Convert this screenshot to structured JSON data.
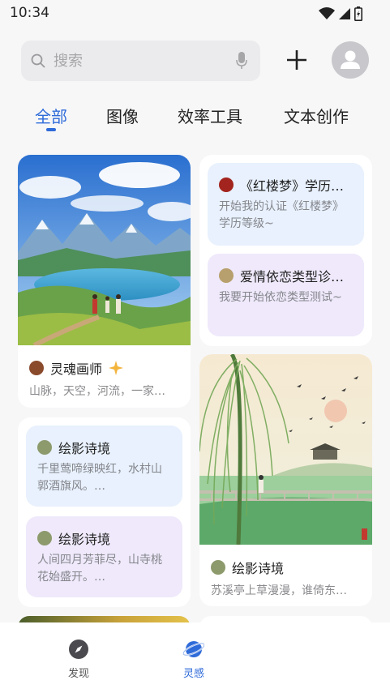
{
  "status": {
    "time": "10:34"
  },
  "search": {
    "placeholder": "搜索"
  },
  "tabs": [
    {
      "label": "全部",
      "active": true
    },
    {
      "label": "图像",
      "active": false
    },
    {
      "label": "效率工具",
      "active": false
    },
    {
      "label": "文本创作",
      "active": false
    }
  ],
  "feed": {
    "card1": {
      "author": "灵魂画师",
      "desc": "山脉，天空，河流，一家…"
    },
    "card2": {
      "items": [
        {
          "title": "《红楼梦》学历…",
          "body": "开始我的认证《红楼梦》学历等级~"
        },
        {
          "title": "爱情依恋类型诊…",
          "body": "我要开始依恋类型测试~"
        }
      ]
    },
    "card3": {
      "items": [
        {
          "title": "绘影诗境",
          "body": "千里莺啼绿映红，水村山郭酒旗风。…"
        },
        {
          "title": "绘影诗境",
          "body": "人间四月芳菲尽，山寺桃花始盛开。…"
        }
      ]
    },
    "card4": {
      "author": "绘影诗境",
      "desc": "苏溪亭上草漫漫，谁倚东…"
    }
  },
  "nav": [
    {
      "label": "发现",
      "icon": "compass-icon",
      "active": false
    },
    {
      "label": "灵感",
      "icon": "planet-icon",
      "active": true
    }
  ],
  "colors": {
    "accent": "#2f6bd9",
    "blue_card": "#e8f1fd",
    "purple_card": "#efe9fb"
  }
}
